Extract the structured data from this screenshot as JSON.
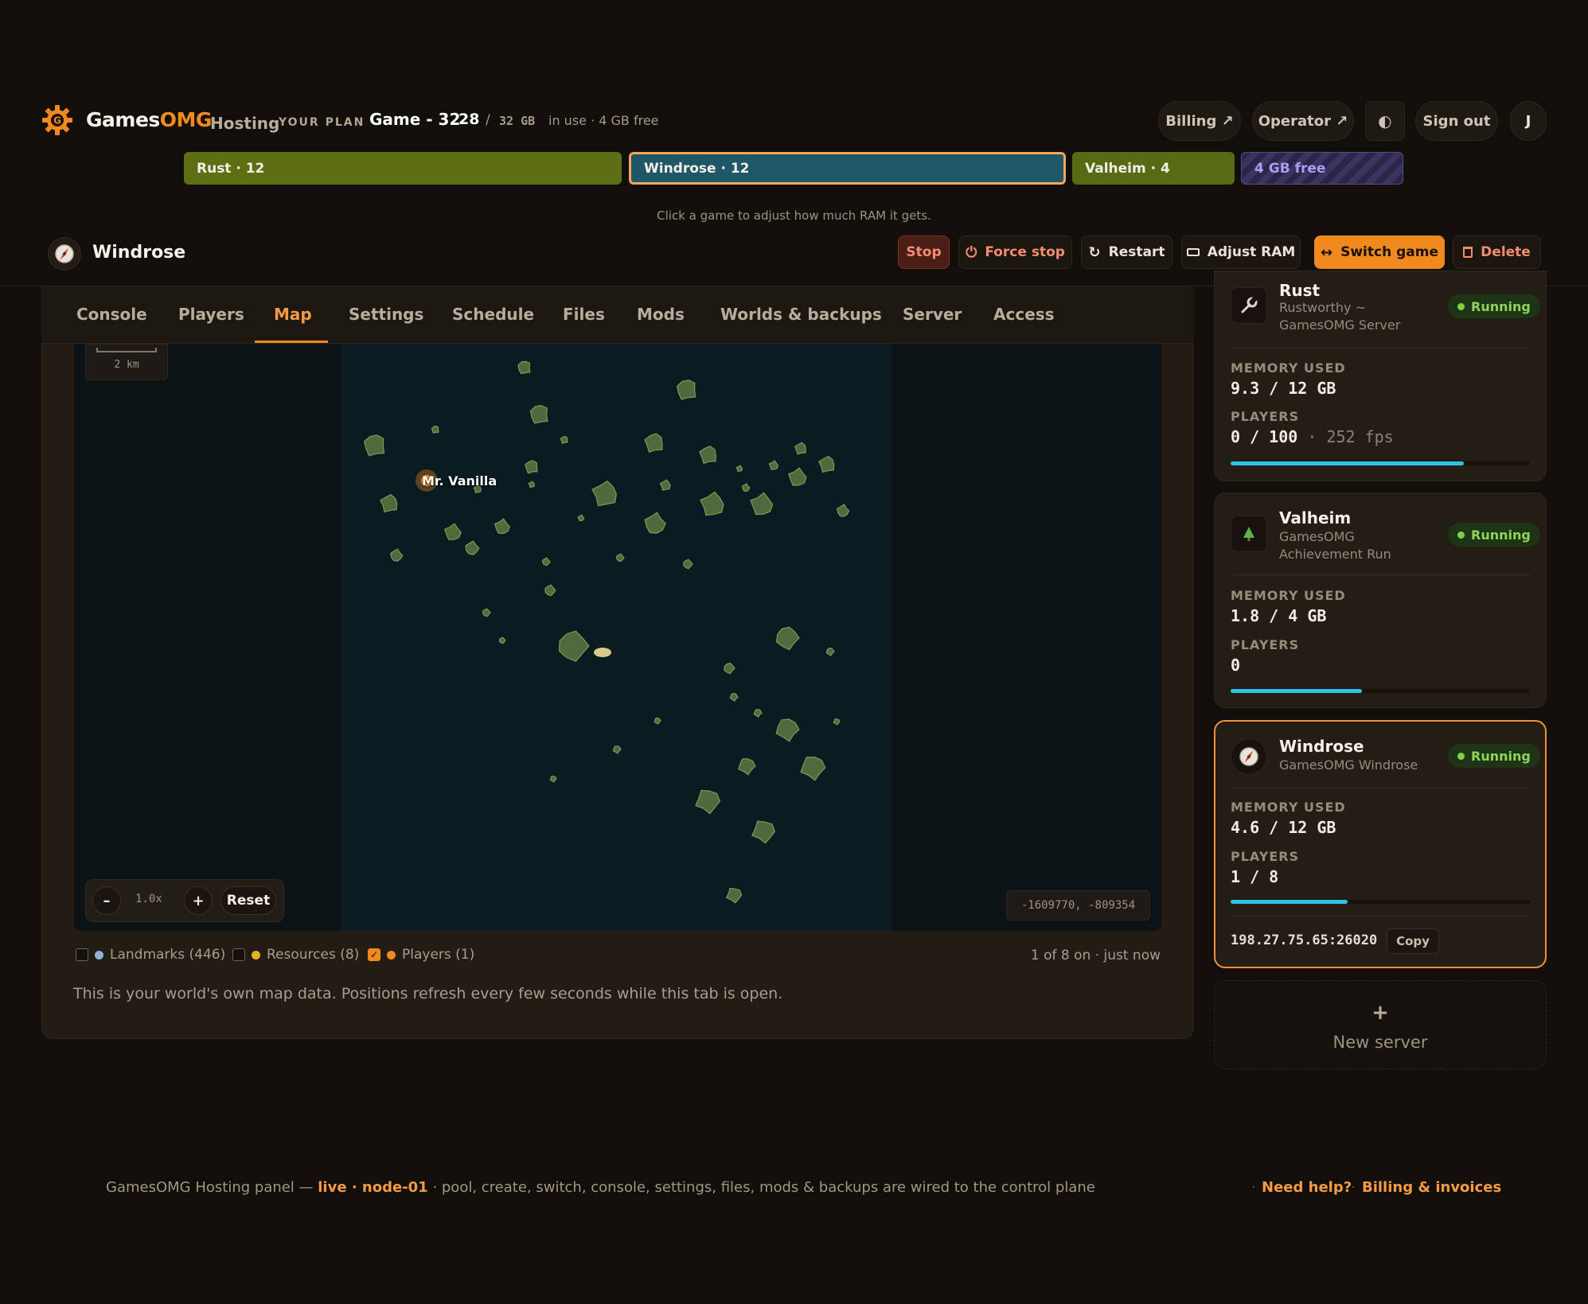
{
  "header": {
    "brand_main": "Games",
    "brand_accent": "OMG",
    "brand_sub": "Hosting",
    "plan_label": "YOUR PLAN",
    "plan_name": "Game - 32",
    "plan_used": "28",
    "plan_slash": "/",
    "plan_total": "32 GB",
    "plan_free": "in use · 4 GB free",
    "billing": "Billing ↗",
    "operator": "Operator ↗",
    "theme_icon": "◐",
    "sign_out": "Sign out",
    "avatar": "J"
  },
  "ram_bar": {
    "segments": [
      {
        "label": "Rust · 12",
        "gb": 12
      },
      {
        "label": "Windrose · 12",
        "gb": 12
      },
      {
        "label": "Valheim · 4",
        "gb": 4
      },
      {
        "label": "4 GB free",
        "gb": 4
      }
    ],
    "hint": "Click a game to adjust how much RAM it gets."
  },
  "server": {
    "name": "Windrose",
    "actions": {
      "stop": "Stop",
      "force_stop": "Force stop",
      "restart": "Restart",
      "adjust_ram": "Adjust RAM",
      "switch_game": "Switch game",
      "delete": "Delete"
    }
  },
  "tabs": [
    "Console",
    "Players",
    "Map",
    "Settings",
    "Schedule",
    "Files",
    "Mods",
    "Worlds & backups",
    "Server",
    "Access"
  ],
  "active_tab": "Map",
  "map": {
    "scale": "2 km",
    "zoom_minus": "–",
    "zoom_level": "1.0x",
    "zoom_plus": "+",
    "reset": "Reset",
    "coords": "-1609770, -809354",
    "player_name": "Mr. Vanilla",
    "legend": {
      "landmarks": "Landmarks (446)",
      "resources": "Resources (8)",
      "players": "Players (1)",
      "landmarks_color": "#8fb3d6",
      "resources_color": "#e6b02d",
      "players_color": "#f08a1e",
      "players_checked": true
    },
    "status": "1 of 8 on · just now",
    "note": "This is your world's own map data. Positions refresh every few seconds while this tab is open."
  },
  "sidebar": {
    "cards": [
      {
        "name": "Rust",
        "sub": "Rustworthy ~ GamesOMG Server",
        "status": "Running",
        "mem_label": "MEMORY USED",
        "mem": "9.3 / 12 GB",
        "players_label": "PLAYERS",
        "players": "0 / 100",
        "extra": "· 252 fps",
        "bar_fraction": 0.78
      },
      {
        "name": "Valheim",
        "sub": "GamesOMG Achievement Run",
        "status": "Running",
        "mem_label": "MEMORY USED",
        "mem": "1.8 / 4 GB",
        "players_label": "PLAYERS",
        "players": "0",
        "bar_fraction": 0.44
      },
      {
        "name": "Windrose",
        "sub": "GamesOMG Windrose",
        "status": "Running",
        "mem_label": "MEMORY USED",
        "mem": "4.6 / 12 GB",
        "players_label": "PLAYERS",
        "players": "1 / 8",
        "bar_fraction": 0.39,
        "address": "198.27.75.65:26020",
        "copy": "Copy"
      }
    ],
    "new_server_plus": "+",
    "new_server": "New server"
  },
  "footer": {
    "text_a": "GamesOMG Hosting panel — ",
    "live": "live · node-01",
    "text_b": " · pool, create, switch, console, settings, files, mods & backups are wired to the control plane",
    "help": "Need help?",
    "billing": "Billing & invoices"
  },
  "colors": {
    "accent": "#f08a1e",
    "running": "#8fd35e",
    "memory_bar": "#2ec4e6"
  }
}
